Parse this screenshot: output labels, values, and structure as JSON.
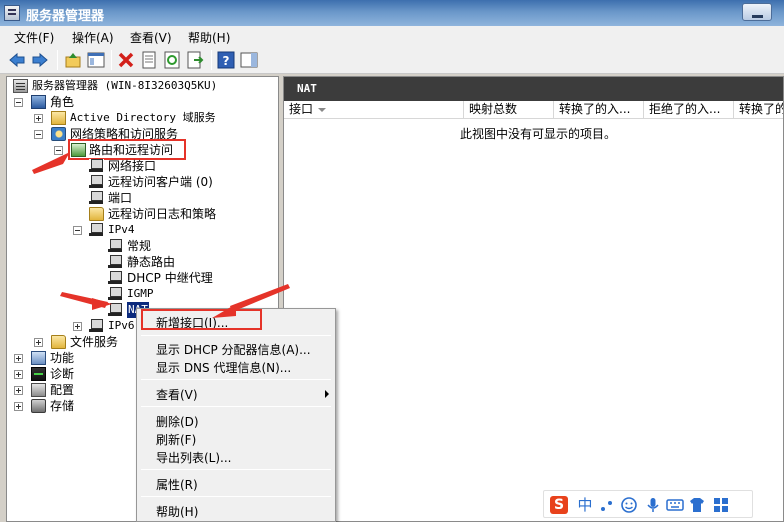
{
  "window": {
    "title": "服务器管理器"
  },
  "menubar": [
    {
      "label": "文件(F)"
    },
    {
      "label": "操作(A)"
    },
    {
      "label": "查看(V)"
    },
    {
      "label": "帮助(H)"
    }
  ],
  "toolbar": {
    "icons": [
      "back-arrow-icon",
      "forward-arrow-icon",
      "up-folder-icon",
      "show-hide-tree-icon",
      "delete-icon",
      "properties-icon",
      "refresh-icon",
      "export-list-icon",
      "help-icon",
      "show-hide-action-pane-icon"
    ]
  },
  "tree": {
    "root": "服务器管理器 (WIN-8I32603Q5KU)",
    "roles": "角色",
    "ad": "Active Directory 域服务",
    "npas": "网络策略和访问服务",
    "rras": "路由和远程访问",
    "net_if": "网络接口",
    "remote_clients": "远程访问客户端 (0)",
    "ports": "端口",
    "logging": "远程访问日志和策略",
    "ipv4": "IPv4",
    "general": "常规",
    "static_routes": "静态路由",
    "dhcp_relay": "DHCP 中继代理",
    "igmp": "IGMP",
    "nat": "NAT",
    "ipv6": "IPv6",
    "file_services": "文件服务",
    "features": "功能",
    "diagnostics": "诊断",
    "configuration": "配置",
    "storage": "存储"
  },
  "right_pane": {
    "header": "NAT",
    "columns": [
      "接口",
      "映射总数",
      "转换了的入...",
      "拒绝了的入...",
      "转换了的"
    ],
    "empty_message": "此视图中没有可显示的项目。"
  },
  "context_menu": {
    "new_interface": "新增接口(I)...",
    "show_dhcp": "显示 DHCP 分配器信息(A)...",
    "show_dns": "显示 DNS 代理信息(N)...",
    "view": "查看(V)",
    "delete": "删除(D)",
    "refresh": "刷新(F)",
    "export": "导出列表(L)...",
    "properties": "属性(R)",
    "help": "帮助(H)"
  },
  "ime": {
    "lang": "中"
  },
  "colors": {
    "annotation_red": "#e53329",
    "selection": "#0b2a7d"
  }
}
